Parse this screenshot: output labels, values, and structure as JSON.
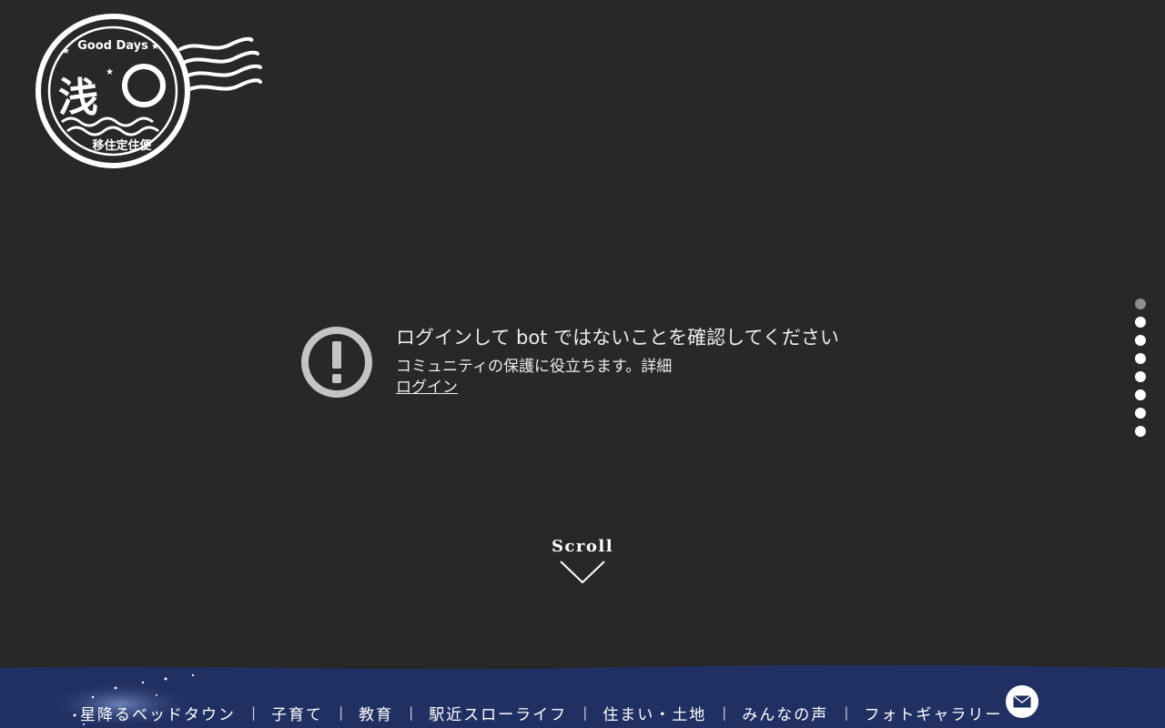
{
  "logo": {
    "top_text": "Good Days",
    "main_char": "浅",
    "bottom_text": "移住定住便"
  },
  "notice": {
    "title": "ログインして bot ではないことを確認してください",
    "subtitle": "コミュニティの保護に役立ちます。",
    "detail_link": "詳細",
    "login_link": "ログイン",
    "icon": "exclamation-circle-icon"
  },
  "side_dots": {
    "count": 8,
    "active_index": 0
  },
  "scroll": {
    "label": "Scroll",
    "icon": "chevron-down-icon"
  },
  "bottom_nav": {
    "background": "#213063",
    "items": [
      "星降るベッドタウン",
      "子育て",
      "教育",
      "駅近スローライフ",
      "住まい・土地",
      "みんなの声",
      "フォトギャラリー"
    ],
    "separator": "|",
    "mail_icon": "envelope-icon"
  }
}
